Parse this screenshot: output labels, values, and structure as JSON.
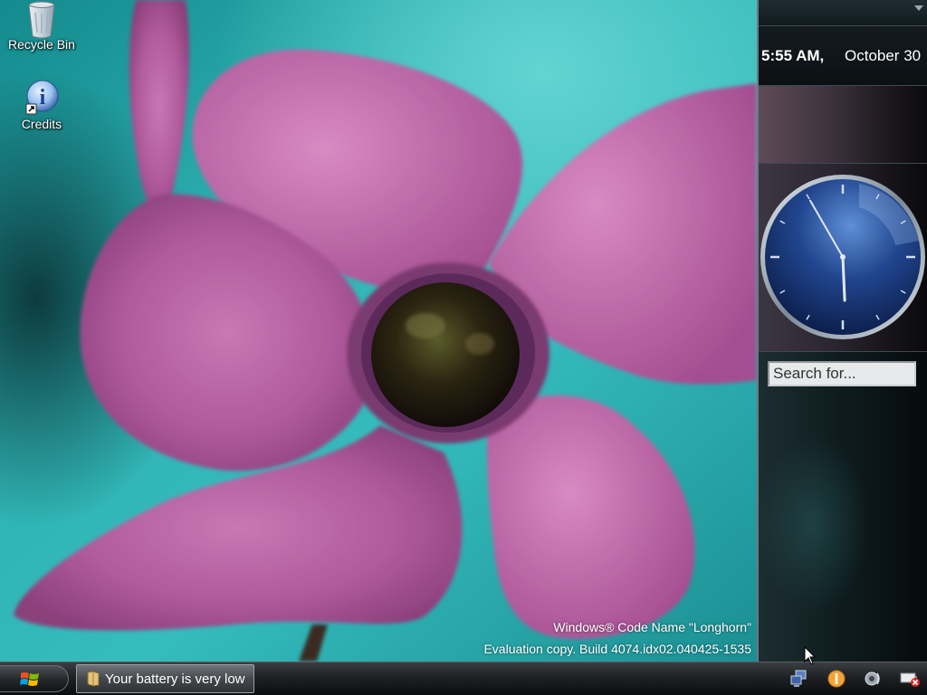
{
  "desktop": {
    "icons": [
      {
        "label": "Recycle Bin",
        "icon": "recycle-bin-icon"
      },
      {
        "label": "Credits",
        "icon": "info-shortcut-icon"
      }
    ],
    "watermark": {
      "line1": "Windows® Code Name \"Longhorn\"",
      "line2": "Evaluation copy. Build 4074.idx02.040425-1535"
    }
  },
  "sidebar": {
    "time": "5:55 AM,",
    "date": "October 30",
    "clock": {
      "hour": 5,
      "minute": 55
    },
    "search_placeholder": "Search for..."
  },
  "taskbar": {
    "start_icon": "windows-flag-icon",
    "tasks": [
      {
        "label": "Your battery is very low",
        "icon": "battery-folder-icon"
      }
    ],
    "tray_icons": [
      "network-icon",
      "info-icon",
      "volume-icon",
      "power-icon"
    ]
  },
  "colors": {
    "wallpaper_teal": "#2fb2b2",
    "petal_pink": "#b05a9c",
    "sidebar_dark": "#0e1519",
    "taskbar_dark": "#1f2124"
  }
}
